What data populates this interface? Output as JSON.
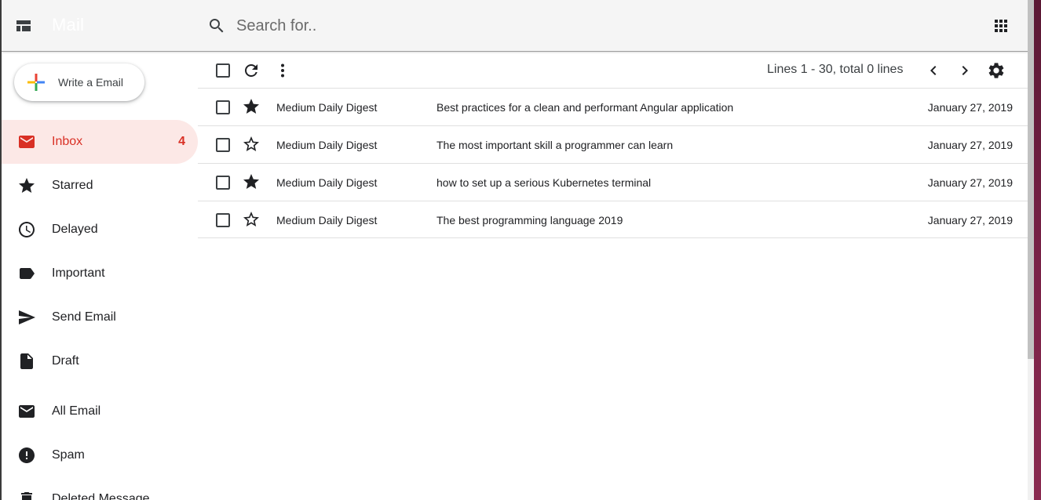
{
  "colors": {
    "accent": "#d93025",
    "active_bg": "#fce8e6",
    "header_bg": "#f5f5f5",
    "star_filled": "#202124"
  },
  "header": {
    "title": "Mail",
    "search_placeholder": "Search for..",
    "search_value": ""
  },
  "compose": {
    "label": "Write a Email"
  },
  "sidebar": {
    "items": [
      {
        "label": "Inbox",
        "icon": "inbox-icon",
        "count": "4",
        "active": true
      },
      {
        "label": "Starred",
        "icon": "star-icon"
      },
      {
        "label": "Delayed",
        "icon": "clock-icon"
      },
      {
        "label": "Important",
        "icon": "label-icon"
      },
      {
        "label": "Send Email",
        "icon": "send-icon"
      },
      {
        "label": "Draft",
        "icon": "draft-icon"
      },
      {
        "label": "All Email",
        "icon": "mail-icon"
      },
      {
        "label": "Spam",
        "icon": "spam-icon"
      },
      {
        "label": "Deleted Message",
        "icon": "trash-icon"
      }
    ]
  },
  "toolbar": {
    "page_info": "Lines 1 - 30, total 0 lines"
  },
  "emails": [
    {
      "sender": "Medium Daily Digest",
      "subject": "Best practices for a clean and performant Angular application",
      "date": "January 27, 2019",
      "starred": true
    },
    {
      "sender": "Medium Daily Digest",
      "subject": "The most important skill a programmer can learn",
      "date": "January 27, 2019",
      "starred": false
    },
    {
      "sender": "Medium Daily Digest",
      "subject": "how to set up a serious Kubernetes terminal",
      "date": "January 27, 2019",
      "starred": true
    },
    {
      "sender": "Medium Daily Digest",
      "subject": "The best programming language 2019",
      "date": "January 27, 2019",
      "starred": false
    }
  ]
}
